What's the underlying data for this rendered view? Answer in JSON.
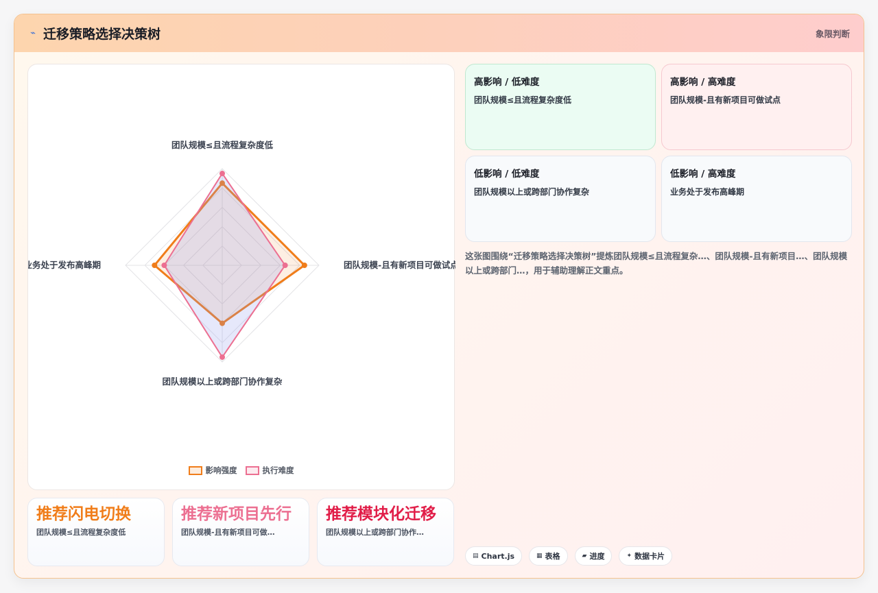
{
  "header": {
    "title": "迁移策略选择决策树",
    "title_icon": "lightning-icon",
    "tag": "象限判断"
  },
  "colors": {
    "impact": "#f07d1a",
    "difficulty": "#ec6f91",
    "verdict_1": "#f07d1a",
    "verdict_2": "#ec6f91",
    "verdict_3": "#e11d48",
    "quad_green_bg": "#ebfcf3",
    "quad_green_border": "#bfe8d0",
    "quad_pink_bg": "#fff0f0",
    "quad_pink_border": "#f6c8cf",
    "quad_gray_bg": "#f8fafc",
    "quad_gray_border": "#e2e6ee"
  },
  "chart_data": {
    "type": "radar",
    "axes": [
      "团队规模≤且流程复杂度低",
      "团队规模-且有新项目可做试点",
      "团队规模以上或跨部门协作复杂",
      "业务处于发布高峰期"
    ],
    "r_range": [
      0,
      100
    ],
    "grid": true,
    "legend_position": "bottom",
    "series": [
      {
        "name": "影响强度",
        "values": [
          85,
          85,
          60,
          70
        ]
      },
      {
        "name": "执行难度",
        "values": [
          95,
          65,
          95,
          60
        ]
      }
    ]
  },
  "verdicts": [
    {
      "title": "推荐闪电切换",
      "sub": "团队规模≤且流程复杂度低"
    },
    {
      "title": "推荐新项目先行",
      "sub": "团队规模-且有新项目可做…"
    },
    {
      "title": "推荐模块化迁移",
      "sub": "团队规模以上或跨部门协作…"
    }
  ],
  "quadrants": [
    {
      "title": "高影响 / 低难度",
      "desc": "团队规模≤且流程复杂度低"
    },
    {
      "title": "高影响 / 高难度",
      "desc": "团队规模-且有新项目可做试点"
    },
    {
      "title": "低影响 / 低难度",
      "desc": "团队规模以上或跨部门协作复杂"
    },
    {
      "title": "低影响 / 高难度",
      "desc": "业务处于发布高峰期"
    }
  ],
  "note": "这张图围绕“迁移策略选择决策树”提炼团队规模≤且流程复杂…、团队规模-且有新项目…、团队规模以上或跨部门…，用于辅助理解正文重点。",
  "chips": [
    {
      "icon": "chart-icon",
      "glyph": "▤",
      "label": "Chart.js"
    },
    {
      "icon": "table-icon",
      "glyph": "▦",
      "label": "表格"
    },
    {
      "icon": "progress-icon",
      "glyph": "▰",
      "label": "进度"
    },
    {
      "icon": "sparkle-icon",
      "glyph": "✦",
      "label": "数据卡片"
    }
  ]
}
